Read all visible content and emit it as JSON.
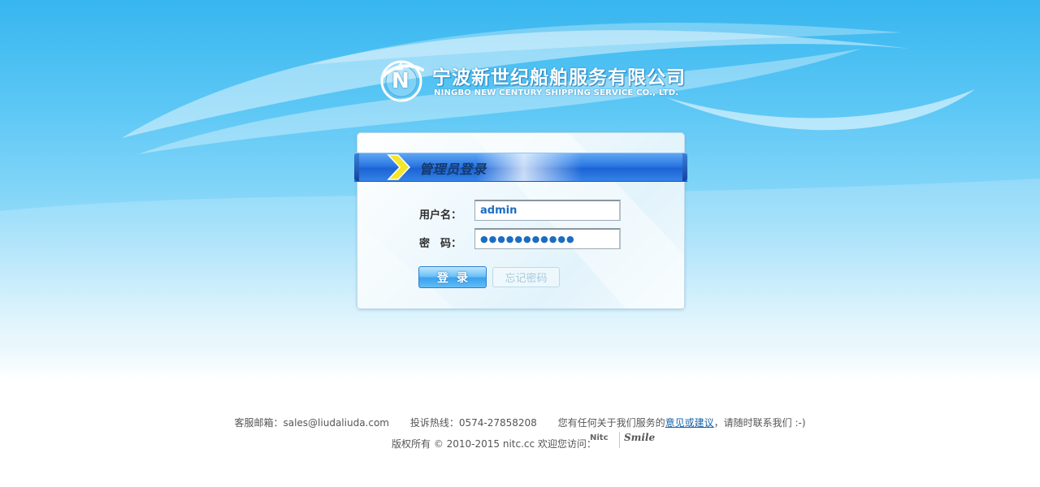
{
  "header": {
    "company_cn": "宁波新世纪船舶服务有限公司",
    "company_en": "NINGBO NEW CENTURY SHIPPING SERVICE CO., LTD.",
    "logo_letters": "N"
  },
  "login": {
    "title": "管理员登录",
    "username_label": "用户名：",
    "username_value": "admin",
    "password_label": "密　码：",
    "password_value": "●●●●●●●●●●●",
    "login_button": "登录",
    "forgot_button": "忘记密码"
  },
  "footer": {
    "email_text": "客服邮箱：sales@liudaliuda.com",
    "hotline_text": "投诉热线：0574-27858208",
    "feedback_prefix": "您有任何关于我们服务的",
    "feedback_link": "意见或建议",
    "feedback_suffix": "，请随时联系我们 :-)",
    "copyright": "版权所有 © 2010-2015 nitc.cc 欢迎您访问：",
    "partner1": "Nitc",
    "partner2": "Smile"
  },
  "colors": {
    "sky_top": "#37b6ef",
    "ribbon_blue": "#2b77e2",
    "arrow_yellow": "#f4e52a",
    "link": "#1762a8"
  }
}
